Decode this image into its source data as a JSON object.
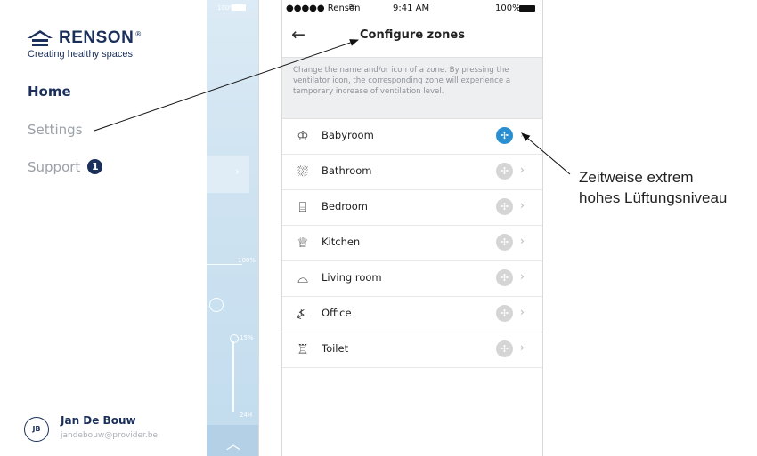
{
  "left_phone": {
    "backdrop_battery": "100%",
    "backdrop_tick_high": "100%",
    "backdrop_tick_mid": "15%",
    "backdrop_tick_low": "24H",
    "logo_text": "RENSON",
    "logo_trademark": "®",
    "tagline": "Creating healthy spaces",
    "nav": {
      "home": "Home",
      "settings": "Settings",
      "support": "Support",
      "support_badge": "1"
    },
    "user": {
      "initials": "JB",
      "name": "Jan De Bouw",
      "email": "jandebouw@provider.be"
    }
  },
  "right_phone": {
    "status": {
      "carrier": "●●●●● Renson",
      "time": "9:41 AM",
      "battery": "100%"
    },
    "title": "Configure zones",
    "intro": "Change the name and/or icon of a zone. By pressing the ventilator icon, the corresponding zone will experience a temporary increase of ventilation level.",
    "zones": [
      {
        "label": "Babyroom",
        "icon": "baby-chair-icon",
        "glyph": "♔",
        "fan_active": true
      },
      {
        "label": "Bathroom",
        "icon": "bathtub-icon",
        "glyph": "⛆",
        "fan_active": false
      },
      {
        "label": "Bedroom",
        "icon": "bed-icon",
        "glyph": "⌸",
        "fan_active": false
      },
      {
        "label": "Kitchen",
        "icon": "chef-hat-icon",
        "glyph": "♕",
        "fan_active": false
      },
      {
        "label": "Living room",
        "icon": "sofa-icon",
        "glyph": "⌓",
        "fan_active": false
      },
      {
        "label": "Office",
        "icon": "desk-lamp-icon",
        "glyph": "⍼",
        "fan_active": false
      },
      {
        "label": "Toilet",
        "icon": "toilet-icon",
        "glyph": "♖",
        "fan_active": false
      }
    ],
    "fan_glyph": "✢",
    "chevron": "›"
  },
  "annotation": {
    "line1": "Zeitweise extrem",
    "line2": "hohes Lüftungsniveau"
  },
  "colors": {
    "brand_navy": "#1a2f5a",
    "fan_active": "#2a8fd0",
    "fan_inactive": "#d5d5d5"
  }
}
